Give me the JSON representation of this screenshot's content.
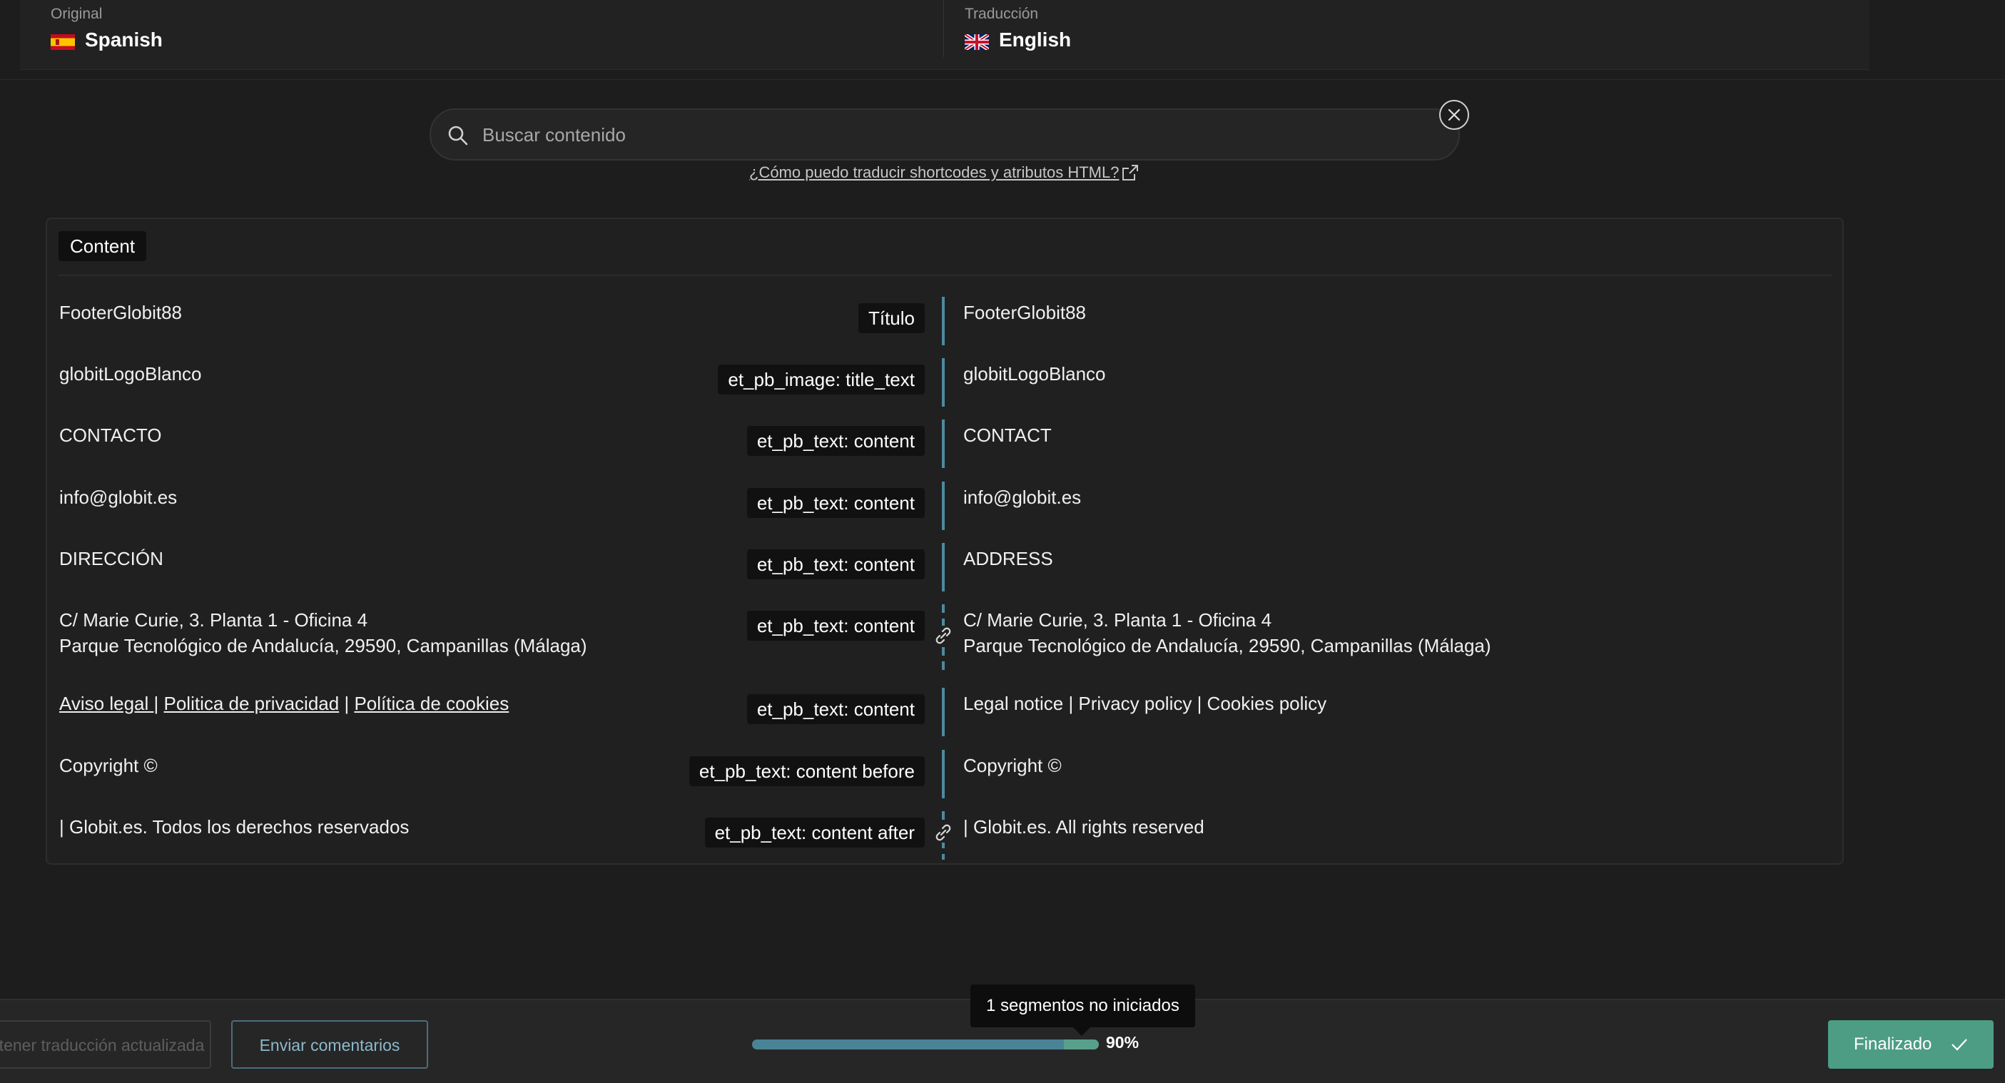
{
  "header": {
    "original_label": "Original",
    "original_language": "Spanish",
    "original_flag_icon": "spain-flag-icon",
    "translation_label": "Traducción",
    "translation_language": "English",
    "translation_flag_icon": "uk-flag-icon"
  },
  "search": {
    "placeholder": "Buscar contenido",
    "value": "",
    "help_link": "¿Cómo puedo traducir shortcodes y atributos HTML?"
  },
  "section": {
    "title": "Content"
  },
  "rows": [
    {
      "source": "FooterGlobit88",
      "tag": "Título",
      "target": "FooterGlobit88",
      "linked": false
    },
    {
      "source": "globitLogoBlanco",
      "tag": "et_pb_image: title_text",
      "target": "globitLogoBlanco",
      "linked": false
    },
    {
      "source": "CONTACTO",
      "tag": "et_pb_text: content",
      "target": "CONTACT",
      "linked": false
    },
    {
      "source": "info@globit.es",
      "tag": "et_pb_text: content",
      "target": "info@globit.es",
      "linked": false
    },
    {
      "source": "DIRECCIÓN",
      "tag": "et_pb_text: content",
      "target": "ADDRESS",
      "linked": false
    },
    {
      "source_line1": "C/ Marie Curie, 3. Planta 1 - Oficina 4",
      "source_line2": "Parque Tecnológico de Andalucía, 29590, Campanillas (Málaga)",
      "tag": "et_pb_text: content",
      "target_line1": "C/ Marie Curie, 3. Planta 1 - Oficina 4",
      "target_line2": "Parque Tecnológico de Andalucía, 29590, Campanillas (Málaga)",
      "linked": true
    },
    {
      "source_links": [
        "Aviso legal ",
        "Politica de privacidad",
        "Política de cookies"
      ],
      "source_separator": "|",
      "tag": "et_pb_text: content",
      "target": "Legal notice | Privacy policy | Cookies policy",
      "linked": false
    },
    {
      "source": "Copyright ©",
      "tag": "et_pb_text: content before",
      "target": "Copyright ©",
      "linked": false
    },
    {
      "source": "| Globit.es. Todos los derechos reservados",
      "tag": "et_pb_text: content after",
      "target": "| Globit.es. All rights reserved",
      "linked": true
    }
  ],
  "footer": {
    "updated_button": "Obtener traducción actualizada",
    "feedback_button": "Enviar comentarios",
    "progress_percent": 90,
    "progress_label": "90%",
    "tooltip": "1 segmentos no iniciados",
    "done_button": "Finalizado"
  },
  "colors": {
    "background": "#1d1d1d",
    "accent_blue": "#4d8aa0",
    "accent_green": "#4d9d85"
  }
}
